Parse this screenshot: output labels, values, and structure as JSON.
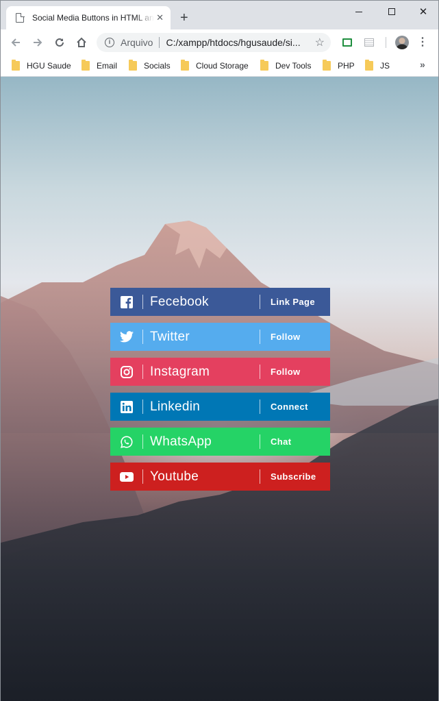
{
  "browser": {
    "tab_title": "Social Media Buttons in HTML and CSS",
    "tab_close": "✕",
    "new_tab": "+",
    "win_close": "✕",
    "omnibox_label": "Arquivo",
    "url": "C:/xampp/htdocs/hgusaude/si...",
    "bookmarks": [
      "HGU Saude",
      "Email",
      "Socials",
      "Cloud Storage",
      "Dev Tools",
      "PHP",
      "JS"
    ],
    "bookmarks_more": "»"
  },
  "social_buttons": [
    {
      "name": "Fecebook",
      "action": "Link Page",
      "icon": "facebook-icon",
      "color": "#3b5998"
    },
    {
      "name": "Twitter",
      "action": "Follow",
      "icon": "twitter-icon",
      "color": "#55acee"
    },
    {
      "name": "Instagram",
      "action": "Follow",
      "icon": "instagram-icon",
      "color": "#e4405f"
    },
    {
      "name": "Linkedin",
      "action": "Connect",
      "icon": "linkedin-icon",
      "color": "#0077b5"
    },
    {
      "name": "WhatsApp",
      "action": "Chat",
      "icon": "whatsapp-icon",
      "color": "#25d366"
    },
    {
      "name": "Youtube",
      "action": "Subscribe",
      "icon": "youtube-icon",
      "color": "#cd201f"
    }
  ]
}
